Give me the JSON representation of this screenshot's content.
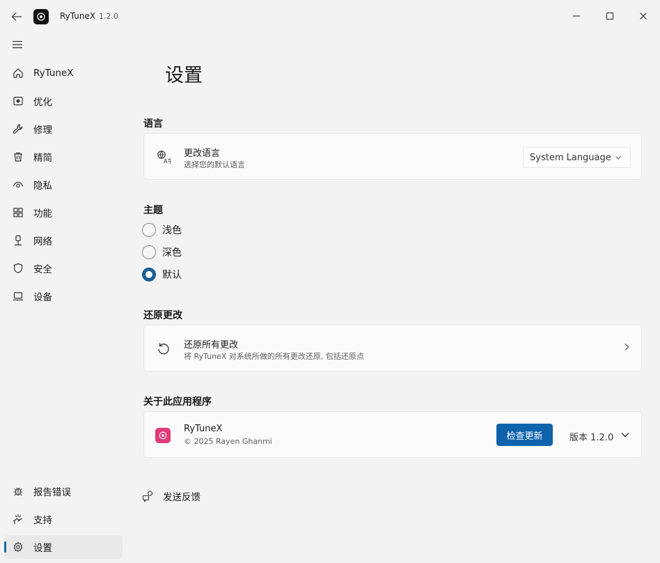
{
  "app": {
    "name": "RyTuneX",
    "version": "1.2.0"
  },
  "sidebar": {
    "items": [
      {
        "label": "RyTuneX",
        "icon": "home-icon"
      },
      {
        "label": "优化",
        "icon": "optimize-icon"
      },
      {
        "label": "修理",
        "icon": "wrench-icon"
      },
      {
        "label": "精简",
        "icon": "trash-icon"
      },
      {
        "label": "隐私",
        "icon": "eye-icon"
      },
      {
        "label": "功能",
        "icon": "apps-icon"
      },
      {
        "label": "网络",
        "icon": "network-icon"
      },
      {
        "label": "安全",
        "icon": "shield-icon"
      },
      {
        "label": "设备",
        "icon": "laptop-icon"
      }
    ],
    "footer_items": [
      {
        "label": "报告错误",
        "icon": "bug-icon"
      },
      {
        "label": "支持",
        "icon": "support-icon"
      },
      {
        "label": "设置",
        "icon": "settings-icon",
        "active": true
      }
    ]
  },
  "page": {
    "title": "设置"
  },
  "language": {
    "section_title": "语言",
    "card_title": "更改语言",
    "card_subtitle": "选择您的默认语言",
    "selected": "System Language"
  },
  "theme": {
    "section_title": "主题",
    "options": [
      {
        "label": "浅色",
        "checked": false
      },
      {
        "label": "深色",
        "checked": false
      },
      {
        "label": "默认",
        "checked": true
      }
    ]
  },
  "revert": {
    "section_title": "还原更改",
    "card_title": "还原所有更改",
    "card_subtitle": "将 RyTuneX 对系统所做的所有更改还原, 包括还原点"
  },
  "about": {
    "section_title": "关于此应用程序",
    "app_name": "RyTuneX",
    "copyright": "© 2025 Rayen Ghanmi",
    "update_button": "检查更新",
    "version_label": "版本 1.2.0"
  },
  "feedback": {
    "label": "发送反馈"
  },
  "colors": {
    "accent": "#0f63ad",
    "about_logo": "#e03a78"
  }
}
